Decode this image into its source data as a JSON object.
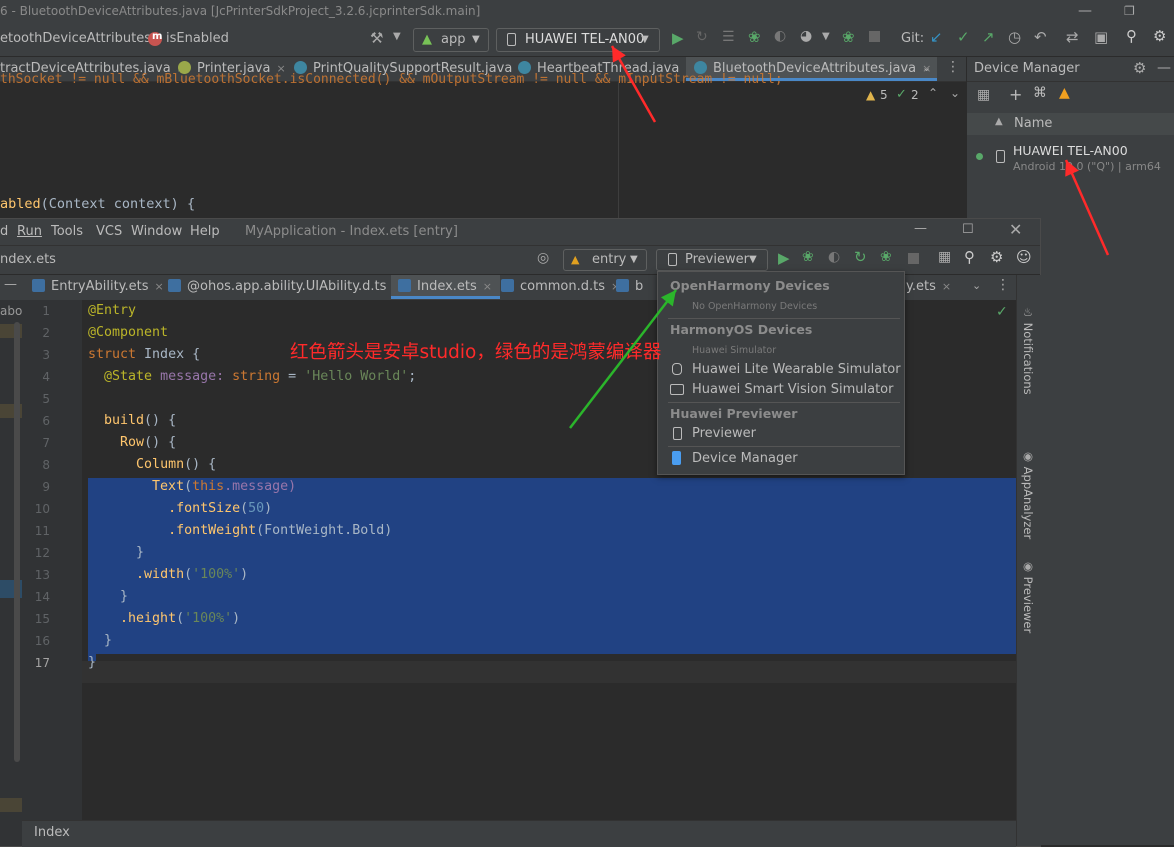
{
  "android_studio": {
    "title": "6 - BluetoothDeviceAttributes.java [JcPrinterSdkProject_3.2.6.jcprinterSdk.main]",
    "breadcrumb": {
      "class": "etoothDeviceAttributes",
      "method": "isEnabled"
    },
    "run_config": "app",
    "device": "HUAWEI TEL-AN00",
    "git_label": "Git:",
    "tabs": [
      "tractDeviceAttributes.java",
      "Printer.java",
      "PrintQualitySupportResult.java",
      "HeartbeatThread.java",
      "BluetoothDeviceAttributes.java"
    ],
    "code_top": "thSocket != null && mBluetoothSocket.isConnected() && mOutputStream != null && mInputStream != null;",
    "code_line": {
      "fn": "abled",
      "rest": "(Context context) {"
    },
    "inspections": {
      "warnings": "5",
      "ok": "2"
    },
    "device_manager": {
      "title": "Device Manager",
      "column": "Name",
      "device_name": "HUAWEI TEL-AN00",
      "device_info": "Android 10.0 (\"Q\") | arm64"
    }
  },
  "deveco": {
    "menu": [
      "d",
      "Run",
      "Tools",
      "VCS",
      "Window",
      "Help"
    ],
    "window_title": "MyApplication - Index.ets [entry]",
    "breadcrumb": "ndex.ets",
    "module": "entry",
    "target": "Previewer",
    "tabs": [
      "EntryAbility.ets",
      "@ohos.app.ability.UIAbility.d.ts",
      "Index.ets",
      "common.d.ts",
      "b",
      "y.ets"
    ],
    "left_panel_label": "abot",
    "status_label": "Index",
    "side_tools": [
      "Notifications",
      "AppAnalyzer",
      "Previewer"
    ],
    "line_numbers": [
      "1",
      "2",
      "3",
      "4",
      "5",
      "6",
      "7",
      "8",
      "9",
      "10",
      "11",
      "12",
      "13",
      "14",
      "15",
      "16",
      "17"
    ],
    "code": [
      {
        "t": "@Entry"
      },
      {
        "t": "@Component"
      },
      {
        "kw": "struct",
        "name": "Index",
        "rest": " {"
      },
      {
        "t": "  @State message: string = 'Hello World';"
      },
      {
        "t": ""
      },
      {
        "fn": "  build",
        "rest": "() {"
      },
      {
        "fn": "    Row",
        "rest": "() {"
      },
      {
        "fn": "      Column",
        "rest": "() {"
      },
      {
        "fn": "        Text",
        "kw": "this",
        "rest": ".message)"
      },
      {
        "fn": "          .fontSize",
        "num": "50"
      },
      {
        "fn": "          .fontWeight",
        "rest": "(FontWeight.Bold)"
      },
      {
        "t": "      }"
      },
      {
        "fn": "      .width",
        "str": "'100%'"
      },
      {
        "t": "    }"
      },
      {
        "fn": "    .height",
        "str": "'100%'"
      },
      {
        "t": "  }"
      },
      {
        "t": "}"
      }
    ],
    "dropdown": {
      "sections": [
        {
          "header": "OpenHarmony Devices",
          "sub": "No OpenHarmony Devices",
          "items": []
        },
        {
          "header": "HarmonyOS Devices",
          "sub": "Huawei Simulator",
          "items": [
            "Huawei Lite Wearable Simulator",
            "Huawei Smart Vision Simulator"
          ]
        },
        {
          "header": "Huawei Previewer",
          "sub": "",
          "items": [
            "Previewer"
          ]
        },
        {
          "header": "",
          "sub": "",
          "items": [
            "Device Manager"
          ]
        }
      ]
    }
  },
  "annotation": "红色箭头是安卓studio，绿色的是鸿蒙编译器",
  "colors": {
    "red_arrow": "#ff2a2a",
    "green_arrow": "#2bb52b",
    "selection": "#214283",
    "accent": "#4a88c7"
  }
}
